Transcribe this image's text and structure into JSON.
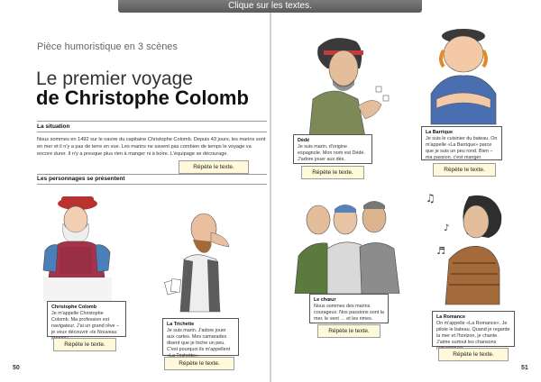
{
  "topbar": {
    "label": "Clique sur les textes."
  },
  "header": {
    "subtitle": "Pièce humoristique en 3 scènes",
    "title_line1": "Le premier voyage",
    "title_line2": "de Christophe Colomb"
  },
  "situation": {
    "heading": "La situation",
    "text": "Nous sommes en 1492 sur le navire du capitaine Christophe Colomb. Depuis 43 jours, les marins sont en mer et il n'y a pas de terre en vue. Les marins ne savent pas combien de temps le voyage va encore durer. Il n'y a presque plus rien à manger ni à boire. L'équipage se décourage.",
    "button": "Répète le texte."
  },
  "characters_heading": "Les personnages se présentent",
  "characters": [
    {
      "name": "Christophe Colomb",
      "text": "Je m'appelle Christophe Colomb. Ma profession est navigateur. J'ai un grand rêve – je veux découvrir «le Nouveau Monde».",
      "button": "Répète le texte."
    },
    {
      "name": "La Trichette",
      "text": "Je suis marin. J'adore jouer aux cartes. Mes camarades disent que je triche un peu. C'est pourquoi ils m'appellent «La Trichette».",
      "button": "Répète le texte."
    },
    {
      "name": "Dédé",
      "text": "Je suis marin, d'origine espagnole. Mon nom est Dédé. J'adore jouer aux dés.",
      "button": "Répète le texte."
    },
    {
      "name": "La Barrique",
      "text": "Je suis le cuisinier du bateau. On m'appelle «La Barrique» parce que je suis un peu rond. Bien – ma passion, c'est manger.",
      "button": "Répète le texte."
    },
    {
      "name": "Le chœur",
      "text": "Nous sommes des marins courageux. Nos passions sont la mer, le vent … et les rimes.",
      "button": "Répète le texte."
    },
    {
      "name": "La Romance",
      "text": "On m'appelle «La Romance». Je pilote le bateau. Quand je regarde la mer et l'horizon, je chante. J'aime surtout les chansons romantiques.",
      "button": "Répète le texte."
    }
  ],
  "pages": {
    "left": "50",
    "right": "51"
  },
  "colors": {
    "topbar": "#666666",
    "button_bg": "#fff9d9",
    "rule": "#999999",
    "colomb_robe": "#a8324a",
    "colomb_sleeve": "#4b7fb9",
    "colomb_hat": "#b8322f",
    "barrique_shirt": "#4a6fb0",
    "romance_shirt": "#a46a3a"
  }
}
